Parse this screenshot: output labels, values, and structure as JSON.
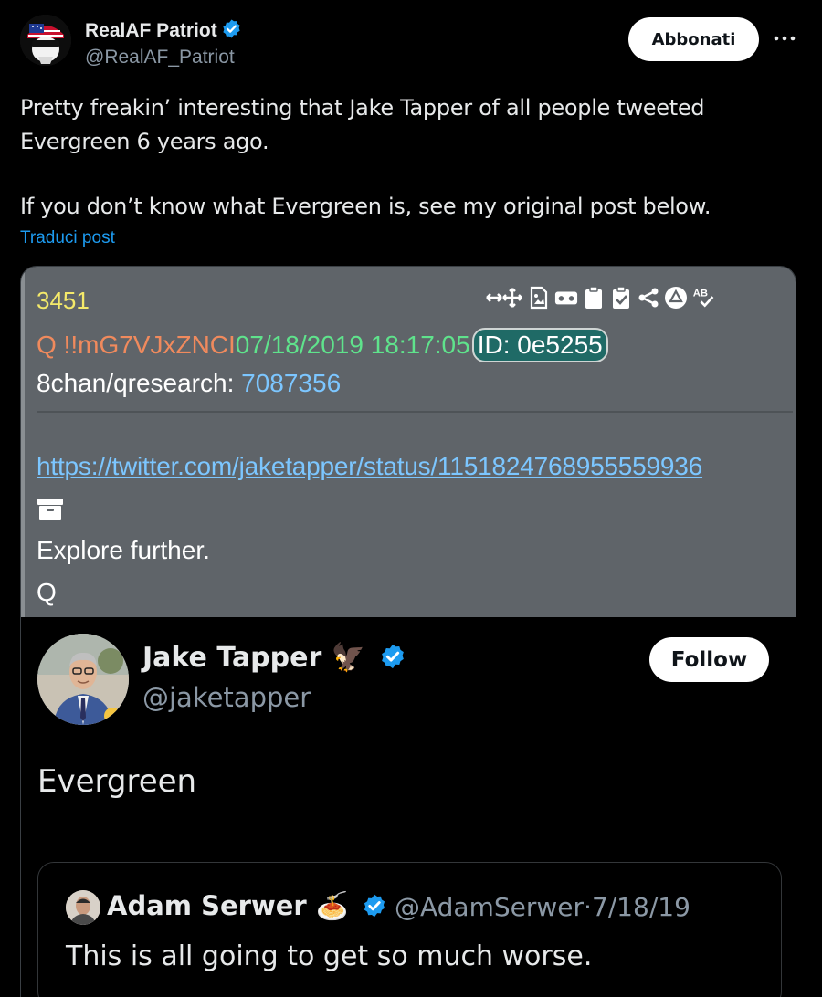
{
  "post": {
    "author": {
      "name": "RealAF Patriot",
      "handle": "@RealAF_Patriot",
      "verified_icon": "verified-badge-icon"
    },
    "subscribe_label": "Abbonati",
    "more_icon": "more-options-icon",
    "text_lines": [
      "Pretty freakin’ interesting that Jake Tapper of all people tweeted Evergreen 6 years ago.",
      "If you don’t know what Evergreen is, see my original post below."
    ],
    "translate_label": "Traduci post"
  },
  "qdrop": {
    "number": "3451",
    "trip": "Q !!mG7VJxZNCI",
    "datetime": "07/18/2019 18:17:05",
    "id_label": "ID: 0e5255",
    "board": "8chan/qresearch:",
    "board_num": "7087356",
    "link": "https://twitter.com/jaketapper/status/1151824768955559936",
    "explore": "Explore further.",
    "signature": "Q",
    "toolbar_icons": [
      "arrows-icon",
      "image-doc-icon",
      "vr-icon",
      "clipboard-icon",
      "clipboard-check-icon",
      "share-icon",
      "up-arrow-icon",
      "translate-icon"
    ],
    "colors": {
      "panel": "#5f6469",
      "number": "#f4e96a",
      "trip": "#f08a5d",
      "date": "#5fe38c",
      "link": "#7cc6ff"
    }
  },
  "embedded_tweet": {
    "name": "Jake Tapper",
    "name_emoji": "🦅",
    "handle": "@jaketapper",
    "follow_label": "Follow",
    "text": "Evergreen",
    "quoted": {
      "name": "Adam Serwer",
      "name_emoji": "🍝",
      "handle": "@AdamSerwer",
      "separator": "·",
      "date": "7/18/19",
      "text": "This is all going to get so much worse."
    }
  },
  "colors": {
    "background": "#000000",
    "accent": "#1d9bf0",
    "verified": "#1d9bf0"
  }
}
